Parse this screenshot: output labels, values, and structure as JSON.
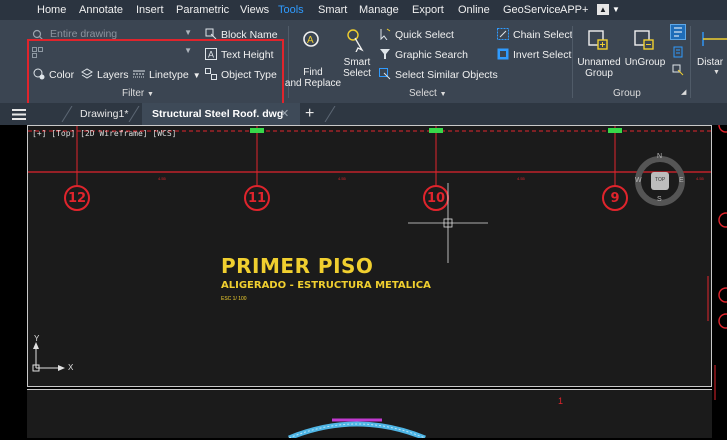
{
  "menu": {
    "items": [
      {
        "label": "Home",
        "active": false
      },
      {
        "label": "Annotate",
        "active": false
      },
      {
        "label": "Insert",
        "active": false
      },
      {
        "label": "Parametric",
        "active": false
      },
      {
        "label": "Views",
        "active": false
      },
      {
        "label": "Tools",
        "active": true
      },
      {
        "label": "Smart",
        "active": false
      },
      {
        "label": "Manage",
        "active": false
      },
      {
        "label": "Export",
        "active": false
      },
      {
        "label": "Online",
        "active": false
      },
      {
        "label": "GeoService",
        "active": false
      },
      {
        "label": "APP+",
        "active": false
      }
    ]
  },
  "ribbon": {
    "filter": {
      "combo1_value": "Entire drawing",
      "combo2_value": "",
      "block_name": "Block Name",
      "text_height": "Text Height",
      "color": "Color",
      "layers": "Layers",
      "linetype": "Linetype",
      "object_type": "Object Type",
      "title": "Filter"
    },
    "select": {
      "find_line1": "Find",
      "find_line2": "and Replace",
      "smart_line1": "Smart",
      "smart_line2": "Select",
      "quick_select": "Quick Select",
      "graphic_search": "Graphic Search",
      "select_similar": "Select Similar Objects",
      "chain_select": "Chain Select",
      "invert_select": "Invert Select",
      "title": "Select"
    },
    "group": {
      "unnamed_line1": "Unnamed",
      "unnamed_line2": "Group",
      "ungroup": "UnGroup",
      "title": "Group"
    },
    "distance_label": "Distar"
  },
  "doc_tabs": {
    "tabs": [
      {
        "label": "Drawing1*",
        "active": false
      },
      {
        "label": "Structural Steel Roof. dwg",
        "active": true
      }
    ],
    "add": "+"
  },
  "viewport": {
    "label": "[+] [Top] [2D Wireframe] [WCS]",
    "grid_markers": [
      "12",
      "11",
      "10",
      "9"
    ],
    "dimension_values": [
      "4.55",
      "4.55",
      "4.55",
      "4.55"
    ],
    "title_main": "PRIMER PISO",
    "title_sub": "ALIGERADO - ESTRUCTURA METALICA",
    "title_scale": "ESC 1/ 100",
    "viewcube": {
      "top": "TOP",
      "n": "N",
      "s": "S",
      "e": "E",
      "w": "W"
    },
    "ucs": {
      "x": "X",
      "y": "Y"
    },
    "lower_marker": "1"
  },
  "colors": {
    "menubar": "#2b3440",
    "ribbon": "#3b4552",
    "doc_tabs": "#2e3742",
    "canvas": "#1b1b1b",
    "accent": "#2f9bff",
    "grid_red": "#e0242c",
    "title_yellow": "#f0cf2f",
    "grip_green": "#38d84a"
  }
}
